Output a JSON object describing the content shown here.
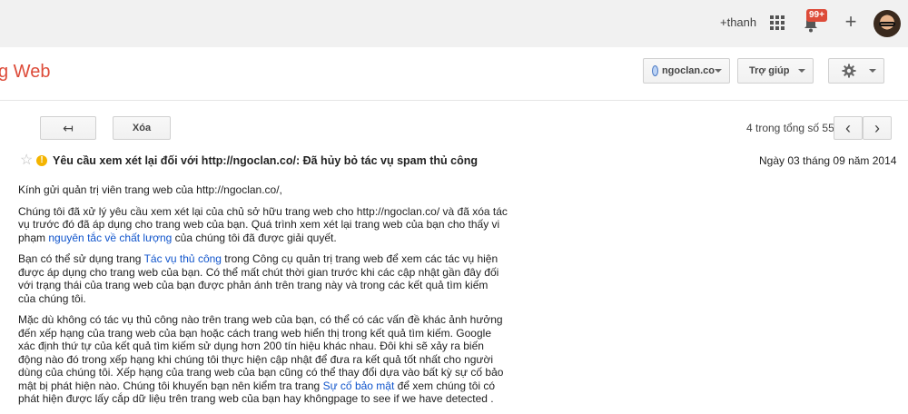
{
  "topbar": {
    "user": "+thanh",
    "notifications": "99+"
  },
  "header": {
    "app_title": "g Web",
    "site": "ngoclan.co",
    "help": "Trợ giúp"
  },
  "toolbar": {
    "delete": "Xóa",
    "count": "4 trong tổng số 55",
    "prev": "‹",
    "next": "›",
    "back": "↤"
  },
  "message": {
    "subject": "Yêu cầu xem xét lại đối với http://ngoclan.co/: Đã hủy bỏ tác vụ spam thủ công",
    "date": "Ngày 03 tháng 09 năm 2014",
    "greeting": "Kính gửi quản trị viên trang web của http://ngoclan.co/,",
    "p1_a": "Chúng tôi đã xử lý yêu cầu xem xét lại của chủ sở hữu trang web cho http://ngoclan.co/ và đã xóa tác vụ trước đó đã áp dụng cho trang web của bạn. Quá trình xem xét lại trang web của bạn cho thấy vi phạm ",
    "p1_link": "nguyên tắc về chất lượng",
    "p1_b": " của chúng tôi đã được giải quyết.",
    "p2_a": "Bạn có thể sử dụng trang ",
    "p2_link": "Tác vụ thủ công",
    "p2_b": " trong Công cụ quản trị trang web để xem các tác vụ hiện được áp dụng cho trang web của bạn. Có thể mất chút thời gian trước khi các cập nhật gần đây đối với trạng thái của trang web của bạn được phản ánh trên trang này và trong các kết quả tìm kiếm của chúng tôi.",
    "p3_a": "Mặc dù không có tác vụ thủ công nào trên trang web của bạn, có thể có các vấn đề khác ảnh hưởng đến xếp hạng của trang web của bạn hoặc cách trang web hiển thị trong kết quả tìm kiếm. Google xác định thứ tự của kết quả tìm kiếm sử dụng hơn 200 tín hiệu khác nhau. Đôi khi sẽ xảy ra biến động nào đó trong xếp hạng khi chúng tôi thực hiện cập nhật để đưa ra kết quả tốt nhất cho người dùng của chúng tôi. Xếp hạng của trang web của bạn cũng có thể thay đổi dựa vào bất kỳ sự cố bảo mật bị phát hiện nào. Chúng tôi khuyến bạn nên kiểm tra trang ",
    "p3_link": "Sự cố bảo mật",
    "p3_b": " để xem chúng tôi có phát hiện được lấy cắp dữ liệu trên trang web của bạn hay khôngpage to see if we have detected ."
  },
  "colors": {
    "accent": "#dd4b39",
    "link": "#1155cc",
    "warning": "#f4b400"
  }
}
